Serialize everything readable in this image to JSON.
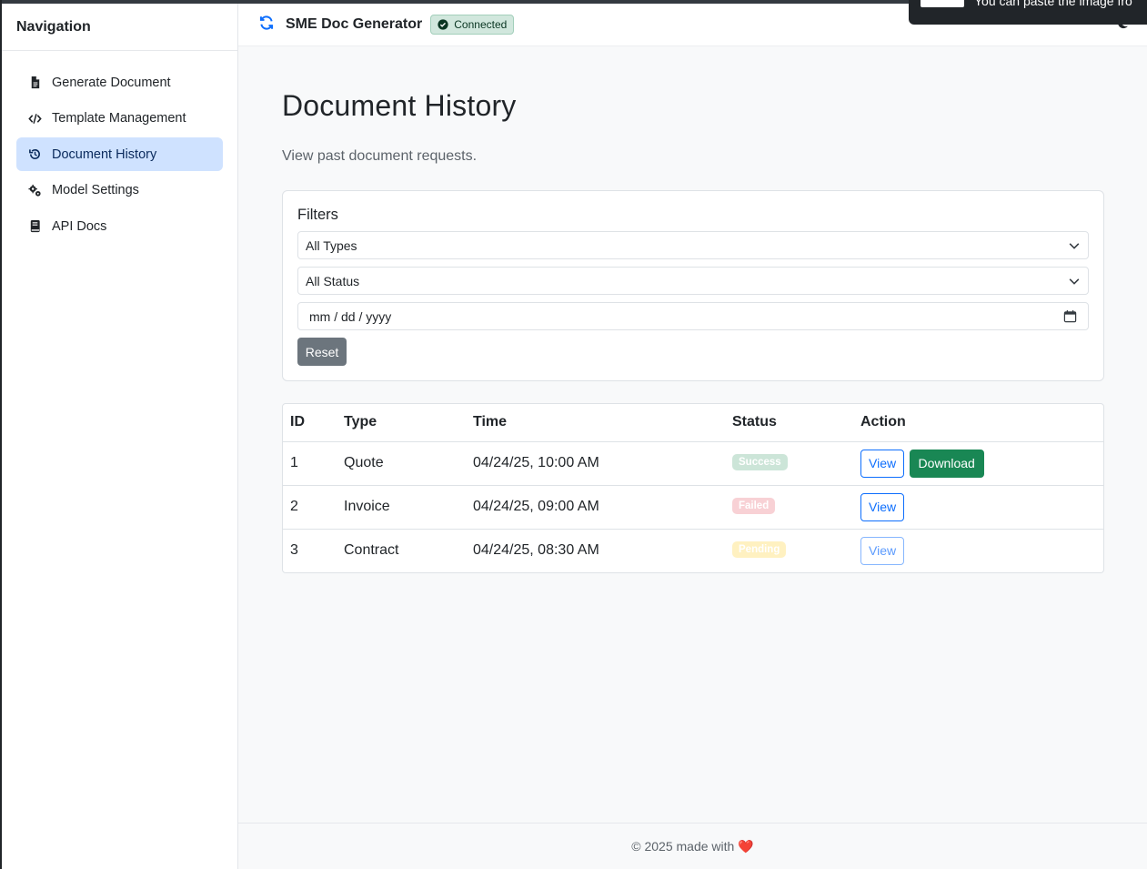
{
  "sidebar": {
    "title": "Navigation",
    "items": [
      {
        "label": "Generate Document",
        "icon": "file-icon"
      },
      {
        "label": "Template Management",
        "icon": "code-icon"
      },
      {
        "label": "Document History",
        "icon": "history-icon",
        "active": true
      },
      {
        "label": "Model Settings",
        "icon": "gears-icon"
      },
      {
        "label": "API Docs",
        "icon": "book-icon"
      }
    ]
  },
  "header": {
    "title": "SME Doc Generator",
    "status": "Connected",
    "toast_text": "You can paste the image fro"
  },
  "main": {
    "title": "Document History",
    "description": "View past document requests.",
    "filters": {
      "title": "Filters",
      "type_select": "All Types",
      "status_select": "All Status",
      "date_placeholder": "mm / dd / yyyy",
      "reset_label": "Reset"
    },
    "table": {
      "headers": [
        "ID",
        "Type",
        "Time",
        "Status",
        "Action"
      ],
      "rows": [
        {
          "id": "1",
          "type": "Quote",
          "time": "04/24/25, 10:00 AM",
          "status": "Success",
          "view": "View",
          "download": "Download"
        },
        {
          "id": "2",
          "type": "Invoice",
          "time": "04/24/25, 09:00 AM",
          "status": "Failed",
          "view": "View"
        },
        {
          "id": "3",
          "type": "Contract",
          "time": "04/24/25, 08:30 AM",
          "status": "Pending",
          "view": "View"
        }
      ]
    }
  },
  "footer": {
    "text": "© 2025 made with",
    "heart": "❤️"
  },
  "colors": {
    "primary": "#0d6efd",
    "success": "#198754",
    "secondary": "#6c757d",
    "active_nav_bg": "#cfe2ff"
  }
}
